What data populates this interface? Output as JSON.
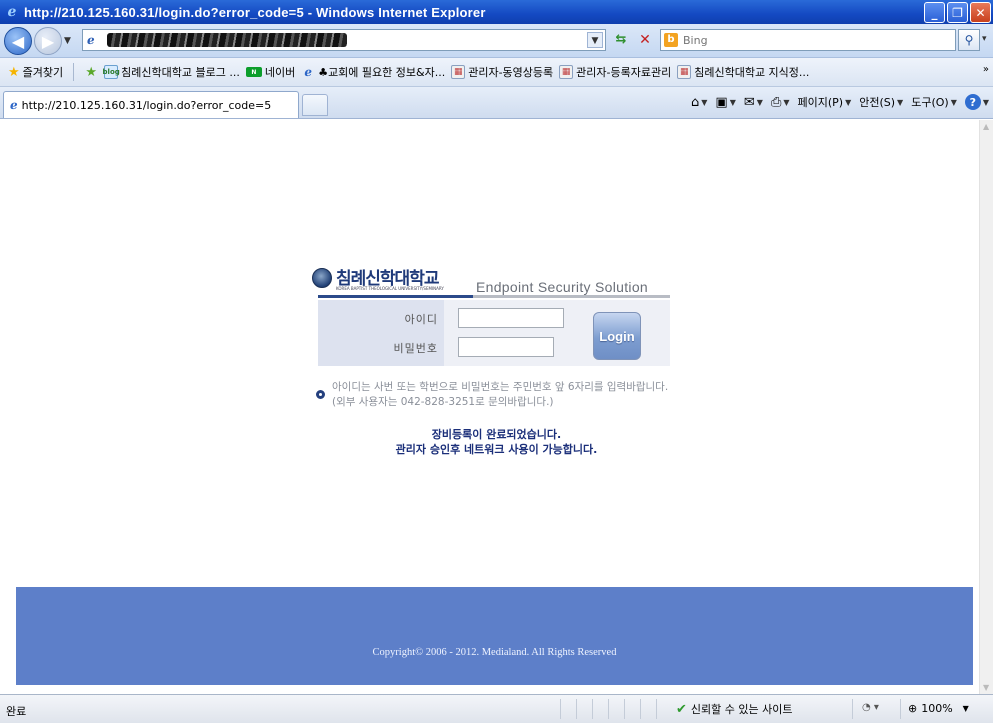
{
  "window": {
    "title": "http://210.125.160.31/login.do?error_code=5 - Windows Internet Explorer"
  },
  "addressbar": {
    "search_placeholder": "Bing"
  },
  "favorites": {
    "label": "즐겨찾기",
    "items": [
      {
        "label": "침례신학대학교 블로그 ...",
        "icon": "blog-icon"
      },
      {
        "label": "네이버",
        "icon": "naver-icon"
      },
      {
        "label": "♣교회에 필요한 정보&자...",
        "icon": "ie-page-icon"
      },
      {
        "label": "관리자-동영상등록",
        "icon": "picture-icon"
      },
      {
        "label": "관리자-등록자료관리",
        "icon": "picture-icon"
      },
      {
        "label": "침례신학대학교 지식정...",
        "icon": "picture-icon"
      }
    ]
  },
  "tab": {
    "label": "http://210.125.160.31/login.do?error_code=5"
  },
  "commandbar": {
    "page": "페이지(P)",
    "safety": "안전(S)",
    "tools": "도구(O)"
  },
  "page": {
    "brand_korean": "침례신학대학교",
    "brand_english": "KOREA BAPTIST THEOLOGICAL UNIVERSITY/SEMINARY",
    "solution": "Endpoint Security Solution",
    "id_label": "아이디",
    "pw_label": "비밀번호",
    "id_value": "",
    "pw_value": "",
    "login_button": "Login",
    "notice": "아이디는 사번 또는 학번으로 비밀번호는 주민번호 앞 6자리를 입력바랍니다. (외부 사용자는 042-828-3251로 문의바랍니다.)",
    "message_line1": "장비등록이 완료되었습니다.",
    "message_line2": "관리자 승인후 네트워크 사용이 가능합니다.",
    "copyright": "Copyright© 2006 - 2012. Medialand. All Rights Reserved"
  },
  "status": {
    "state": "완료",
    "zone": "신뢰할 수 있는 사이트",
    "zoom": "100%"
  }
}
